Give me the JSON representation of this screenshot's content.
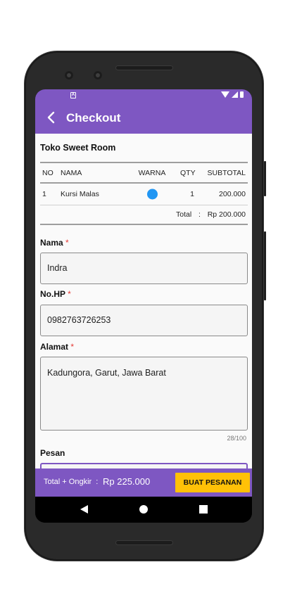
{
  "app": {
    "title": "Checkout",
    "back_icon": "arrow-left-icon",
    "accent_color": "#7e57c2",
    "button_color": "#ffc107"
  },
  "store": {
    "name": "Toko Sweet Room"
  },
  "order_table": {
    "headers": {
      "no": "NO",
      "nama": "NAMA",
      "warna": "WARNA",
      "qty": "QTY",
      "subtotal": "SUBTOTAL"
    },
    "rows": [
      {
        "no": "1",
        "nama": "Kursi Malas",
        "warna_color": "#2196f3",
        "qty": "1",
        "subtotal": "200.000"
      }
    ],
    "total_label": "Total",
    "total_separator": ":",
    "total_value": "Rp 200.000"
  },
  "form": {
    "nama": {
      "label": "Nama",
      "required": "*",
      "value": "Indra"
    },
    "hp": {
      "label": "No.HP",
      "required": "*",
      "value": "0982763726253"
    },
    "alamat": {
      "label": "Alamat",
      "required": "*",
      "value": "Kadungora, Garut, Jawa Barat",
      "counter": "28/100"
    },
    "pesan": {
      "label": "Pesan",
      "value": ""
    }
  },
  "footer": {
    "total_label": "Total + Ongkir",
    "separator": ":",
    "total_value": "Rp 225.000",
    "order_button": "BUAT PESANAN"
  }
}
